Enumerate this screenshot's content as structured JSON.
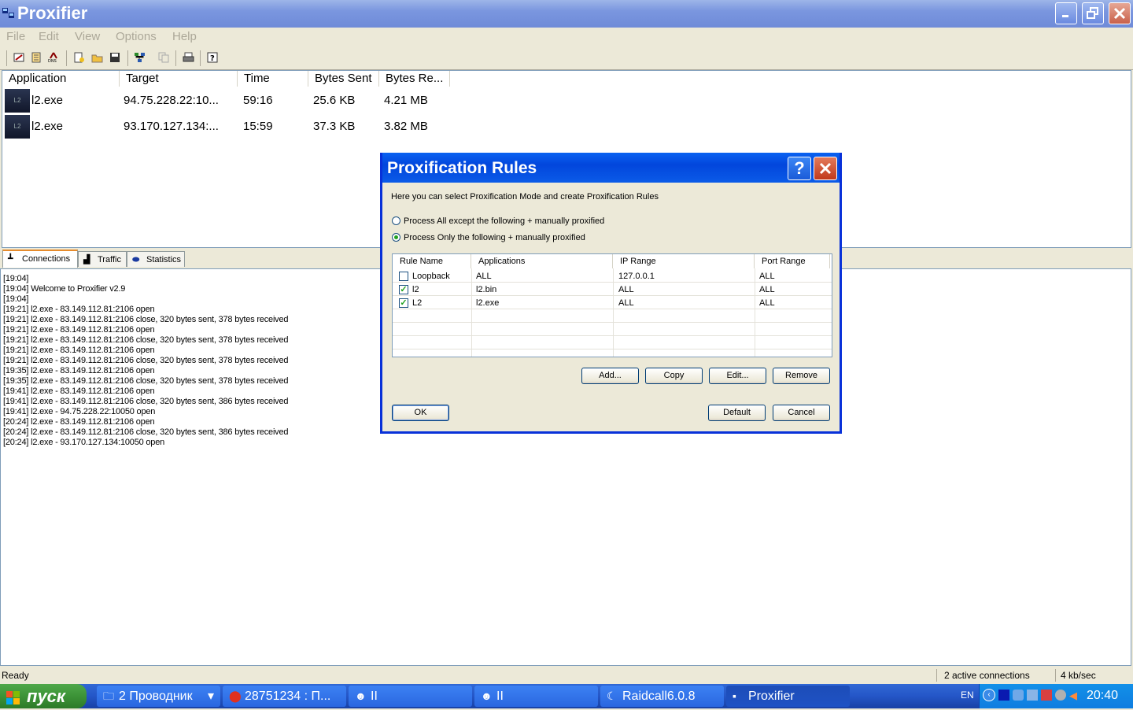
{
  "window": {
    "title": "Proxifier",
    "min_icon": "minimize-icon",
    "max_icon": "restore-icon",
    "close_icon": "close-icon"
  },
  "menu": [
    "File",
    "Edit",
    "View",
    "Options",
    "Help"
  ],
  "toolbar_icons": [
    "proxy-servers-icon",
    "rules-icon",
    "dns-icon",
    "new-profile-icon",
    "open-profile-icon",
    "save-profile-icon",
    "network-icon",
    "copy-icon",
    "print-icon",
    "help-icon"
  ],
  "list": {
    "columns": [
      "Application",
      "Target",
      "Time",
      "Bytes Sent",
      "Bytes Re..."
    ],
    "rows": [
      {
        "app": "l2.exe",
        "target": "94.75.228.22:10...",
        "time": "59:16",
        "sent": "25.6 KB",
        "received": "4.21 MB"
      },
      {
        "app": "l2.exe",
        "target": "93.170.127.134:...",
        "time": "15:59",
        "sent": "37.3 KB",
        "received": "3.82 MB"
      }
    ]
  },
  "tabs": [
    "Connections",
    "Traffic",
    "Statistics"
  ],
  "log": [
    "[19:04]",
    "[19:04]  Welcome to Proxifier v2.9",
    "[19:04]",
    "[19:21] l2.exe - 83.149.112.81:2106 open",
    "[19:21] l2.exe - 83.149.112.81:2106 close, 320 bytes sent, 378 bytes received",
    "[19:21] l2.exe - 83.149.112.81:2106 open",
    "[19:21] l2.exe - 83.149.112.81:2106 close, 320 bytes sent, 378 bytes received",
    "[19:21] l2.exe - 83.149.112.81:2106 open",
    "[19:21] l2.exe - 83.149.112.81:2106 close, 320 bytes sent, 378 bytes received",
    "[19:35] l2.exe - 83.149.112.81:2106 open",
    "[19:35] l2.exe - 83.149.112.81:2106 close, 320 bytes sent, 378 bytes received",
    "[19:41] l2.exe - 83.149.112.81:2106 open",
    "[19:41] l2.exe - 83.149.112.81:2106 close, 320 bytes sent, 386 bytes received",
    "[19:41] l2.exe - 94.75.228.22:10050 open",
    "[20:24] l2.exe - 83.149.112.81:2106 open",
    "[20:24] l2.exe - 83.149.112.81:2106 close, 320 bytes sent, 386 bytes received",
    "[20:24] l2.exe - 93.170.127.134:10050 open"
  ],
  "status": {
    "left": "Ready",
    "connections": "2 active connections",
    "speed": "4 kb/sec"
  },
  "dialog": {
    "title": "Proxification Rules",
    "intro": "Here you can select Proxification Mode and create Proxification Rules",
    "mode_all": "Process All except the following + manually proxified",
    "mode_only": "Process Only the following + manually proxified",
    "selected_mode": "only",
    "columns": [
      "Rule Name",
      "Applications",
      "IP Range",
      "Port Range"
    ],
    "rules": [
      {
        "checked": false,
        "name": "Loopback",
        "apps": "ALL",
        "ip": "127.0.0.1",
        "port": "ALL"
      },
      {
        "checked": true,
        "name": "l2",
        "apps": "l2.bin",
        "ip": "ALL",
        "port": "ALL"
      },
      {
        "checked": true,
        "name": "L2",
        "apps": "l2.exe",
        "ip": "ALL",
        "port": "ALL"
      }
    ],
    "buttons": {
      "add": "Add...",
      "copy": "Copy",
      "edit": "Edit...",
      "remove": "Remove",
      "ok": "OK",
      "default": "Default",
      "cancel": "Cancel"
    },
    "help_icon": "question-icon",
    "close_icon": "close-icon"
  },
  "taskbar": {
    "start": "пуск",
    "tasks": [
      {
        "label": "2 Проводник",
        "icon": "folder-icon"
      },
      {
        "label": "28751234 : П...",
        "icon": "opera-icon"
      },
      {
        "label": "II",
        "icon": "game-icon"
      },
      {
        "label": "II",
        "icon": "game-icon"
      },
      {
        "label": "Raidcall6.0.8",
        "icon": "raidcall-icon"
      },
      {
        "label": "Proxifier",
        "icon": "proxifier-icon"
      }
    ],
    "lang": "EN",
    "clock": "20:40"
  }
}
